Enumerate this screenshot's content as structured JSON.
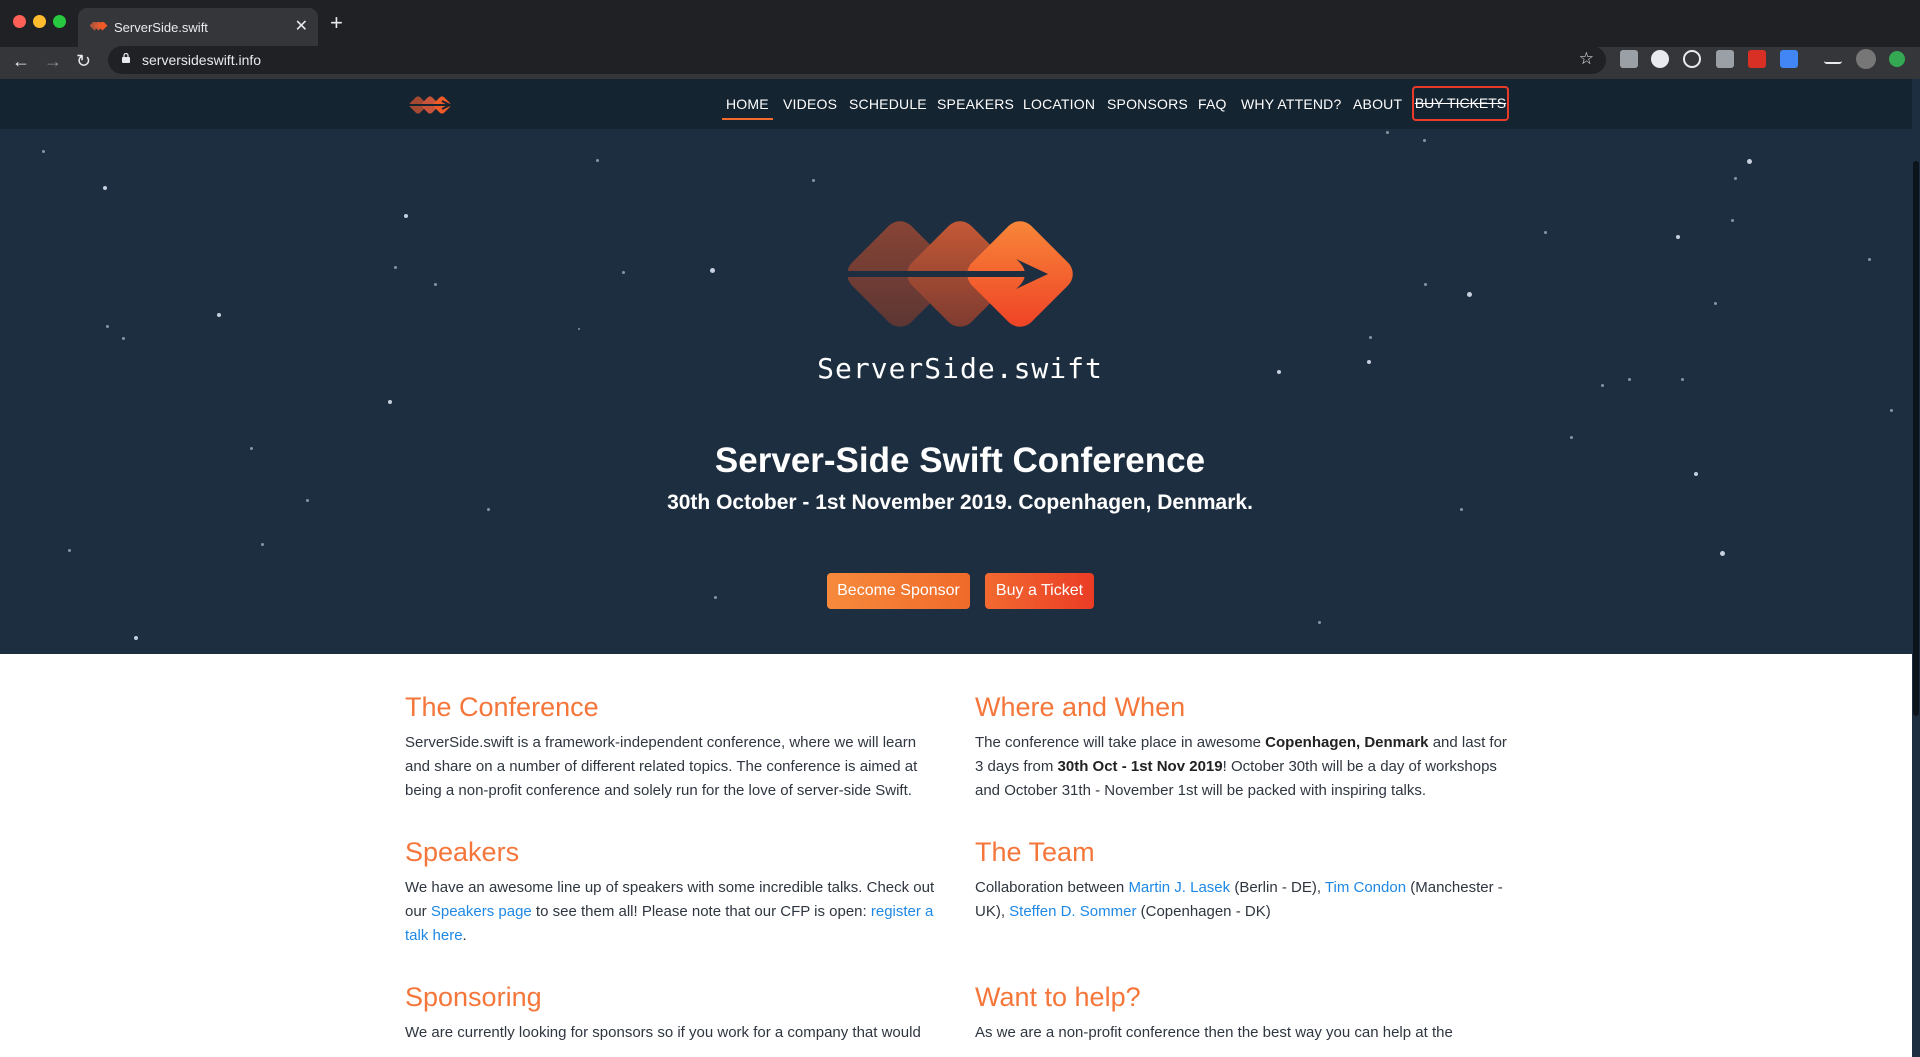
{
  "browser": {
    "tab_title": "ServerSide.swift",
    "url": "serversideswift.info"
  },
  "nav": {
    "items": [
      "HOME",
      "VIDEOS",
      "SCHEDULE",
      "SPEAKERS",
      "LOCATION",
      "SPONSORS",
      "FAQ",
      "WHY ATTEND?",
      "ABOUT"
    ],
    "active": "HOME",
    "buy_tickets": "BUY TICKETS"
  },
  "hero": {
    "brand": "ServerSide.swift",
    "title": "Server-Side Swift Conference",
    "subtitle": "30th October - 1st November 2019. Copenhagen, Denmark.",
    "become_sponsor": "Become Sponsor",
    "buy_ticket": "Buy a Ticket"
  },
  "sections": {
    "conference": {
      "heading": "The Conference",
      "text": "ServerSide.swift is a framework-independent conference, where we will learn and share on a number of different related topics. The conference is aimed at being a non-profit conference and solely run for the love of server-side Swift."
    },
    "where_when": {
      "heading": "Where and When",
      "t1": "The conference will take place in awesome ",
      "city": "Copenhagen, Denmark",
      "t2": " and last for 3 days from ",
      "dates": "30th Oct - 1st Nov 2019",
      "t3": "! October 30th will be a day of workshops and October 31th - November 1st will be packed with inspiring talks."
    },
    "speakers": {
      "heading": "Speakers",
      "t1": "We have an awesome line up of speakers with some incredible talks. Check out our ",
      "link1": "Speakers page",
      "t2": " to see them all! Please note that our CFP is open: ",
      "link2": "register a talk here",
      "t3": "."
    },
    "team": {
      "heading": "The Team",
      "t1": "Collaboration between ",
      "m1": "Martin J. Lasek",
      "t2": " (Berlin - DE), ",
      "m2": "Tim Condon",
      "t3": " (Manchester - UK), ",
      "m3": "Steffen D. Sommer",
      "t4": " (Copenhagen - DK)"
    },
    "sponsoring": {
      "heading": "Sponsoring",
      "text": "We are currently looking for sponsors so if you work for a company that would"
    },
    "help": {
      "heading": "Want to help?",
      "text": "As we are a non-profit conference then the best way you can help at the"
    }
  },
  "colors": {
    "accent": "#f5763a",
    "hero_bg": "#1c2e40",
    "nav_bg": "#152431",
    "link": "#1e88e5"
  },
  "icons": [
    "back-icon",
    "forward-icon",
    "reload-icon",
    "lock-icon",
    "star-icon",
    "close-icon",
    "plus-icon"
  ]
}
